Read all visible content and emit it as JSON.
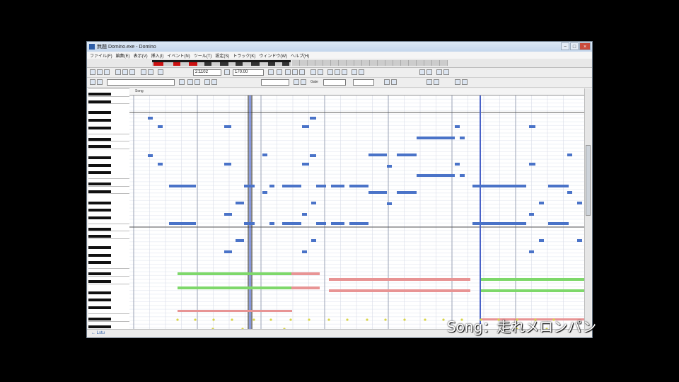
{
  "window": {
    "title": "無題 Domino.exe - Domino",
    "min_label": "−",
    "max_label": "□",
    "close_label": "×"
  },
  "menu": [
    "ファイル(F)",
    "編集(E)",
    "表示(V)",
    "挿入(I)",
    "イベント(N)",
    "ツール(T)",
    "設定(S)",
    "トラック(K)",
    "ウィンドウ(W)",
    "ヘルプ(H)"
  ],
  "toolbar": {
    "position_value": "2:1102",
    "tempo_value": "170.00",
    "gate_label": "Gate"
  },
  "ruler": {
    "label": "Song"
  },
  "status": {
    "text": "← Lstu"
  },
  "caption": {
    "text": "Song：走れメロンパン"
  },
  "colors": {
    "melody": "#4a73c8",
    "chord_green": "#7ed86a",
    "chord_pink": "#e89494",
    "drum_dot": "#d8d44a",
    "playhead": "#4a63c8",
    "grid": "#d8dce8"
  }
}
